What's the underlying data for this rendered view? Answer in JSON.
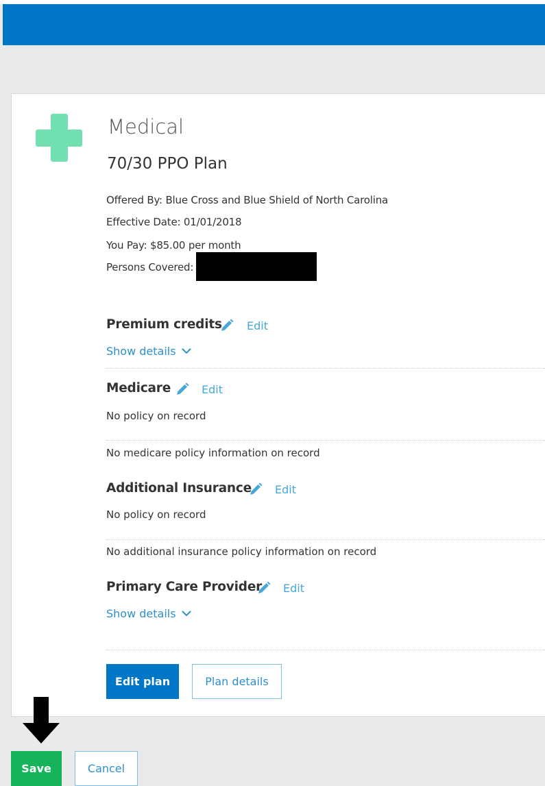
{
  "plan": {
    "category": "Medical",
    "name": "70/30 PPO Plan",
    "offered_by": "Offered By: Blue Cross and Blue Shield of North Carolina",
    "effective_date": "Effective Date: 01/01/2018",
    "you_pay": "You Pay: $85.00 per month",
    "persons_covered_label": "Persons Covered:"
  },
  "sections": {
    "premium_credits": {
      "title": "Premium credits",
      "edit_label": "Edit",
      "show_details": "Show details"
    },
    "medicare": {
      "title": "Medicare",
      "edit_label": "Edit",
      "status": "No policy on record",
      "note": "No medicare policy information on record"
    },
    "additional_insurance": {
      "title": "Additional Insurance",
      "edit_label": "Edit",
      "status": "No policy on record",
      "note": "No additional insurance policy information on record"
    },
    "primary_care_provider": {
      "title": "Primary Care Provider",
      "edit_label": "Edit",
      "show_details": "Show details"
    }
  },
  "actions": {
    "edit_plan": "Edit plan",
    "plan_details": "Plan details",
    "save": "Save",
    "cancel": "Cancel"
  },
  "colors": {
    "header": "#0076c6",
    "plus_icon": "#73e0b1",
    "link": "#2f8fc9",
    "save_button": "#16b35a"
  },
  "icons": {
    "plan_icon": "plus-icon",
    "edit_icon": "pencil-icon",
    "expand_icon": "chevron-down-icon",
    "pointer_icon": "arrow-down-icon"
  }
}
